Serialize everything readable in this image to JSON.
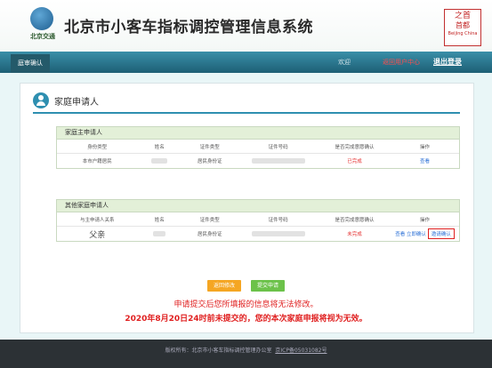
{
  "header": {
    "logo_text": "北京交通",
    "title": "北京市小客车指标调控管理信息系统",
    "seal": {
      "line1": "之首",
      "line2": "首都",
      "sub": "Beijing China"
    }
  },
  "nav": {
    "tab": "庭审确认",
    "welcome": "欢迎",
    "user_center": "返回用户中心",
    "logout": "退出登录"
  },
  "section": {
    "title": "家庭申请人"
  },
  "main_applicant": {
    "title": "家庭主申请人",
    "headers": [
      "身份类型",
      "姓名",
      "证件类型",
      "证件号码",
      "是否完成意愿确认",
      "操作"
    ],
    "row": {
      "identity": "本市户籍居民",
      "id_type": "居民身份证",
      "status": "已完成",
      "action": "查看"
    }
  },
  "other_applicants": {
    "title": "其他家庭申请人",
    "headers": [
      "与主申请人关系",
      "姓名",
      "证件类型",
      "证件号码",
      "是否完成意愿确认",
      "操作"
    ],
    "row": {
      "relation": "父亲",
      "id_type": "居民身份证",
      "status": "未完成",
      "action_view": "查看",
      "action_confirm": "立即确认",
      "action_invite": "邀请确认"
    }
  },
  "buttons": {
    "back": "返回修改",
    "submit": "提交申请"
  },
  "notices": {
    "line1": "申请提交后您所填报的信息将无法修改。",
    "line2": "2020年8月20日24时前未提交的，您的本次家庭申报将视为无效。"
  },
  "footer": {
    "text": "版权所有：北京市小客车指标调控管理办公室",
    "icp": "京ICP备05031082号"
  },
  "colors": {
    "accent": "#2e8fb0",
    "warning": "#e02020",
    "link": "#2a6fd6"
  }
}
